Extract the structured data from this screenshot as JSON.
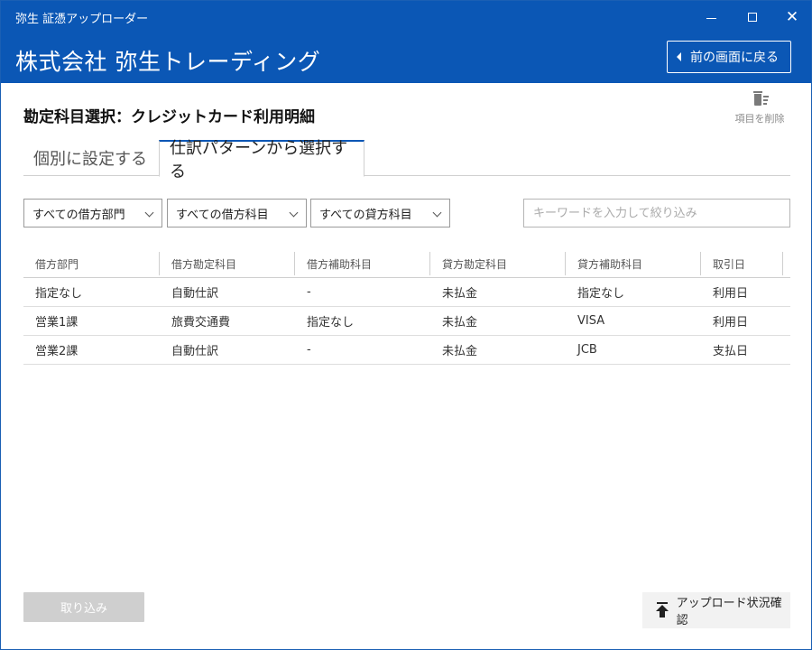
{
  "window": {
    "app_title": "弥生 証憑アップローダー",
    "minimize_label": "",
    "maximize_label": "",
    "close_label": "✕"
  },
  "header": {
    "company": "株式会社 弥生トレーディング",
    "back_button": "前の画面に戻る"
  },
  "page": {
    "title": "勘定科目選択：クレジットカード利用明細",
    "delete_item_label": "項目を削除"
  },
  "tabs": [
    {
      "label": "個別に設定する",
      "active": false
    },
    {
      "label": "仕訳パターンから選択する",
      "active": true
    }
  ],
  "filters": {
    "debit_department": "すべての借方部門",
    "debit_account": "すべての借方科目",
    "credit_account": "すべての貸方科目",
    "search_placeholder": "キーワードを入力して絞り込み",
    "search_value": ""
  },
  "table": {
    "columns": [
      "借方部門",
      "借方勘定科目",
      "借方補助科目",
      "貸方勘定科目",
      "貸方補助科目",
      "取引日"
    ],
    "rows": [
      [
        "指定なし",
        "自動仕訳",
        "-",
        "未払金",
        "指定なし",
        "利用日"
      ],
      [
        "営業1課",
        "旅費交通費",
        "指定なし",
        "未払金",
        "VISA",
        "利用日"
      ],
      [
        "営業2課",
        "自動仕訳",
        "-",
        "未払金",
        "JCB",
        "支払日"
      ]
    ]
  },
  "footer": {
    "import_button": "取り込み",
    "upload_status_button": "アップロード状況確認"
  },
  "colors": {
    "brand_blue": "#0b57b5",
    "disabled_button": "#cfcfcf"
  }
}
